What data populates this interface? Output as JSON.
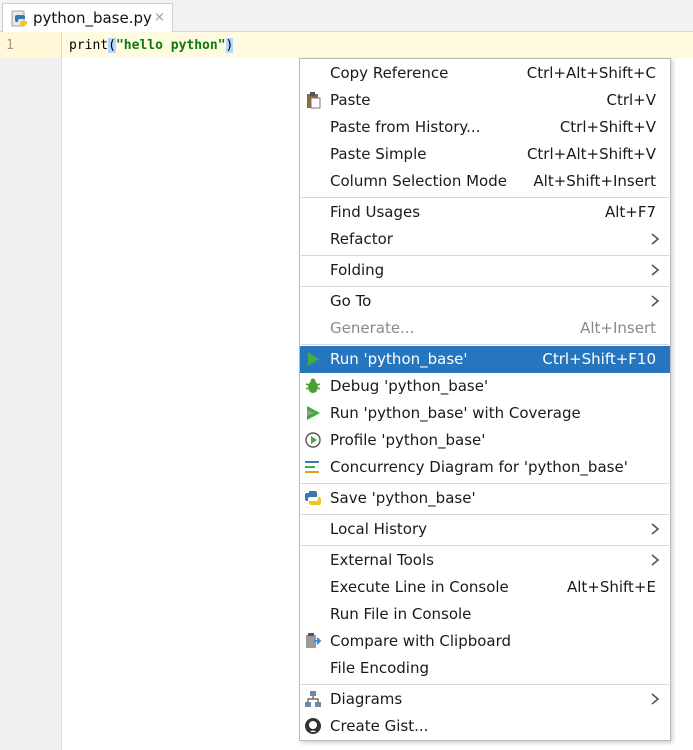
{
  "tab": {
    "title": "python_base.py",
    "close": "×"
  },
  "editor": {
    "line_number": "1",
    "code": {
      "func": "print",
      "open": "(",
      "string": "\"hello python\"",
      "close": ")"
    }
  },
  "menu": {
    "items": [
      {
        "label": "Copy Reference",
        "shortcut": "Ctrl+Alt+Shift+C"
      },
      {
        "label": "Paste",
        "shortcut": "Ctrl+V",
        "icon": "clipboard-icon"
      },
      {
        "label": "Paste from History...",
        "shortcut": "Ctrl+Shift+V"
      },
      {
        "label": "Paste Simple",
        "shortcut": "Ctrl+Alt+Shift+V"
      },
      {
        "label": "Column Selection Mode",
        "shortcut": "Alt+Shift+Insert"
      },
      {
        "label": "Find Usages",
        "shortcut": "Alt+F7"
      },
      {
        "label": "Refactor",
        "submenu": true
      },
      {
        "label": "Folding",
        "submenu": true
      },
      {
        "label": "Go To",
        "submenu": true
      },
      {
        "label": "Generate...",
        "shortcut": "Alt+Insert",
        "disabled": true
      },
      {
        "label": "Run 'python_base'",
        "shortcut": "Ctrl+Shift+F10",
        "icon": "run-icon",
        "selected": true
      },
      {
        "label": "Debug 'python_base'",
        "icon": "debug-icon"
      },
      {
        "label": "Run 'python_base' with Coverage",
        "icon": "coverage-icon"
      },
      {
        "label": "Profile 'python_base'",
        "icon": "profile-icon"
      },
      {
        "label": "Concurrency Diagram for 'python_base'",
        "icon": "concurrency-icon"
      },
      {
        "label": "Save 'python_base'",
        "icon": "python-icon"
      },
      {
        "label": "Local History",
        "submenu": true
      },
      {
        "label": "External Tools",
        "submenu": true
      },
      {
        "label": "Execute Line in Console",
        "shortcut": "Alt+Shift+E"
      },
      {
        "label": "Run File in Console"
      },
      {
        "label": "Compare with Clipboard",
        "icon": "compare-icon"
      },
      {
        "label": "File Encoding"
      },
      {
        "label": "Diagrams",
        "submenu": true,
        "icon": "diagram-icon"
      },
      {
        "label": "Create Gist...",
        "icon": "github-icon"
      }
    ]
  }
}
